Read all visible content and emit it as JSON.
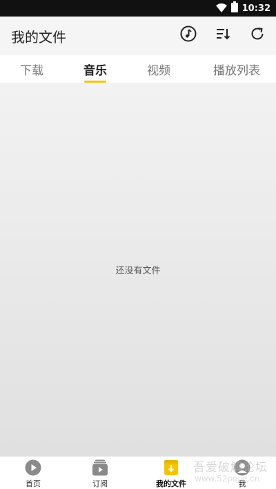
{
  "status_bar": {
    "time": "10:32"
  },
  "header": {
    "title": "我的文件",
    "actions": [
      "music-note-icon",
      "sort-icon",
      "refresh-icon"
    ]
  },
  "tabs": [
    {
      "label": "下载",
      "active": false
    },
    {
      "label": "音乐",
      "active": true
    },
    {
      "label": "视频",
      "active": false
    },
    {
      "label": "播放列表",
      "active": false
    }
  ],
  "content": {
    "empty_text": "还没有文件"
  },
  "bottom_nav": [
    {
      "label": "首页",
      "icon": "play-icon",
      "active": false
    },
    {
      "label": "订阅",
      "icon": "subscription-icon",
      "active": false
    },
    {
      "label": "我的文件",
      "icon": "download-file-icon",
      "active": true
    },
    {
      "label": "我",
      "icon": "profile-icon",
      "active": false
    }
  ],
  "watermark": {
    "line1": "吾爱破解论坛",
    "line2": "www.52pojie.cn"
  },
  "colors": {
    "accent": "#f6c400",
    "status_bar": "#111111",
    "app_bar": "#f5f5f5"
  }
}
